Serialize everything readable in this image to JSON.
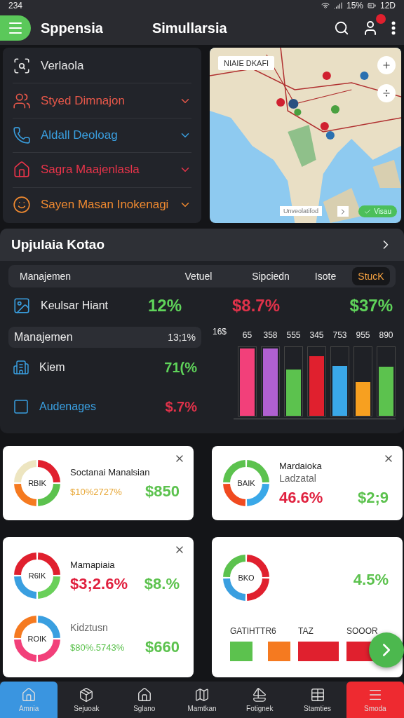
{
  "status_bar": {
    "time": "234",
    "battery": "15%",
    "clock": "12D"
  },
  "header": {
    "title": "Sppensia",
    "subtitle": "Simullarsia",
    "notification": true
  },
  "menu_items": [
    {
      "label": "Verlaola",
      "color": "#e8e8e8",
      "kind": "search",
      "chevron": false
    },
    {
      "label": "Styed Dimnajon",
      "color": "#e8584a",
      "kind": "people",
      "chevron": true
    },
    {
      "label": "Aldall Deoloag",
      "color": "#3a9fe0",
      "kind": "phone",
      "chevron": true
    },
    {
      "label": "Sagra Maajenlasla",
      "color": "#e8344a",
      "kind": "home",
      "chevron": true
    },
    {
      "label": "Sayen Masan Inokenagi",
      "color": "#f08a30",
      "kind": "face",
      "chevron": true
    }
  ],
  "map": {
    "label": "NIAIE DKAFI",
    "footer": "Unveolatifod",
    "button": "Visau"
  },
  "summary": {
    "title": "Upjulaia Kotao",
    "columns": [
      {
        "label": "Manajemen",
        "selected": false
      },
      {
        "label": "Vetuel",
        "selected": false
      },
      {
        "label": "Sipciedn",
        "selected": false
      },
      {
        "label": "Isote",
        "selected": false
      },
      {
        "label": "StucK",
        "selected": true
      }
    ],
    "row": {
      "label": "Keulsar Hiant",
      "values": [
        {
          "text": "12%",
          "color": "#5fd35a"
        },
        {
          "text": "$8.7%",
          "color": "#e0324a"
        },
        {
          "text": "$37%",
          "color": "#5fd35a"
        }
      ]
    },
    "list": [
      {
        "label": "Manajemen",
        "value": "13;1%",
        "selected": true,
        "kind": "plain",
        "color": "#e8e8e8"
      },
      {
        "label": "Kiem",
        "value": "71(%",
        "selected": false,
        "kind": "building",
        "color": "#5fd35a"
      },
      {
        "label": "Audenages",
        "value": "$.7%",
        "selected": false,
        "kind": "square",
        "color": "#e0324a"
      }
    ],
    "chart": {
      "axis_label": "16$",
      "bars": [
        {
          "label": "65",
          "color": "#f2407a",
          "level": 1
        },
        {
          "label": "358",
          "color": "#b060d0",
          "level": 1
        },
        {
          "label": "555",
          "color": "#5cc24e",
          "level": 0.69
        },
        {
          "label": "345",
          "color": "#e0202e",
          "level": 0.89
        },
        {
          "label": "753",
          "color": "#3aa8e8",
          "level": 0.74
        },
        {
          "label": "955",
          "color": "#f7a020",
          "level": 0.5
        },
        {
          "label": "890",
          "color": "#5cc24e",
          "level": 0.73
        }
      ]
    }
  },
  "cards": [
    {
      "closable": true,
      "entries": [
        {
          "title": "Soctanai Manalsian",
          "donut": {
            "label": "RBIK",
            "segments": [
              {
                "color": "#e0202e"
              },
              {
                "color": "#5cc24e"
              },
              {
                "color": "#f57a20"
              },
              {
                "color": "#ede5c0"
              }
            ]
          },
          "values": [
            {
              "kind": "note",
              "text": "$10%2727%",
              "color": "#e8a838"
            },
            {
              "kind": "amount",
              "text": "$850",
              "color": "#5cc24e"
            }
          ]
        }
      ]
    },
    {
      "closable": true,
      "entries": [
        {
          "title": "Mardaioka",
          "subtitle": "Ladzatal",
          "donut": {
            "label": "BAIK",
            "segments": [
              {
                "color": "#5cc24e"
              },
              {
                "color": "#3aa8e8"
              },
              {
                "color": "#f04a20"
              },
              {
                "color": "#5cc24e"
              }
            ]
          },
          "values": [
            {
              "kind": "amount",
              "text": "46.6%",
              "color": "#e0203e"
            },
            {
              "kind": "amount",
              "text": "$2;9",
              "color": "#5cc24e"
            }
          ]
        }
      ]
    },
    {
      "closable": true,
      "entries": [
        {
          "title": "Mamapiaia",
          "donut": {
            "label": "R6IK",
            "segments": [
              {
                "color": "#e0202e"
              },
              {
                "color": "#6ad05a"
              },
              {
                "color": "#3a9fe0"
              },
              {
                "color": "#e0202e"
              }
            ]
          },
          "values": [
            {
              "kind": "amount",
              "text": "$3;2.6%",
              "color": "#e0203e"
            },
            {
              "kind": "amount",
              "text": "$8.%",
              "color": "#5cc24e"
            }
          ]
        },
        {
          "subtitle": "Kidztusn",
          "donut": {
            "label": "ROIK",
            "segments": [
              {
                "color": "#3a9fe0"
              },
              {
                "color": "#f2407a"
              },
              {
                "color": "#f2407a"
              },
              {
                "color": "#f57a20"
              }
            ]
          },
          "values": [
            {
              "kind": "note",
              "text": "$80%.5743%",
              "color": "#5cc24e"
            },
            {
              "kind": "amount",
              "text": "$660",
              "color": "#5cc24e"
            }
          ]
        }
      ]
    },
    {
      "closable": false,
      "entries": [
        {
          "donut": {
            "label": "BKO",
            "segments": [
              {
                "color": "#e0202e"
              },
              {
                "color": "#e0202e"
              },
              {
                "color": "#3a9fe0"
              },
              {
                "color": "#5cc24e"
              }
            ]
          },
          "values": [
            {
              "kind": "amount",
              "text": "4.5%",
              "color": "#5cc24e"
            }
          ]
        }
      ],
      "legend": [
        {
          "label": "GATIHTTR6",
          "swatches": [
            {
              "color": "#5cc24e"
            },
            {
              "color": "#f57a20"
            }
          ]
        },
        {
          "label": "TAZ",
          "swatches": [
            {
              "color": "#e0202e"
            }
          ]
        },
        {
          "label": "SOOOR",
          "swatches": [
            {
              "color": "#e0202e"
            }
          ]
        }
      ],
      "fab": true
    }
  ],
  "nav": [
    {
      "label": "Amnia",
      "kind": "home",
      "selected": true,
      "accent": false
    },
    {
      "label": "Sejuoak",
      "kind": "box",
      "selected": false,
      "accent": false
    },
    {
      "label": "Sglano",
      "kind": "house",
      "selected": false,
      "accent": false
    },
    {
      "label": "Mamtkan",
      "kind": "map",
      "selected": false,
      "accent": false
    },
    {
      "label": "Fotignek",
      "kind": "ship",
      "selected": false,
      "accent": false
    },
    {
      "label": "Stamties",
      "kind": "grid",
      "selected": false,
      "accent": false
    },
    {
      "label": "Smoda",
      "kind": "menu",
      "selected": false,
      "accent": true
    }
  ]
}
